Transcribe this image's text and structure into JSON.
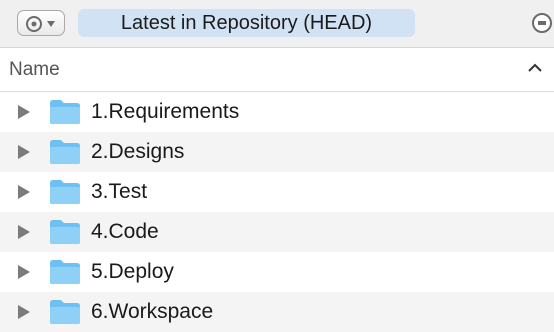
{
  "toolbar": {
    "view_menu_icon": "eye-icon",
    "repository_label": "Latest in Repository (HEAD)",
    "right_icon": "actions-icon"
  },
  "list": {
    "column_header": "Name",
    "sort_icon": "chevron-up-icon",
    "items": [
      {
        "label": "1.Requirements",
        "icon": "folder-icon"
      },
      {
        "label": "2.Designs",
        "icon": "folder-icon"
      },
      {
        "label": "3.Test",
        "icon": "folder-icon"
      },
      {
        "label": "4.Code",
        "icon": "folder-icon"
      },
      {
        "label": "5.Deploy",
        "icon": "folder-icon"
      },
      {
        "label": "6.Workspace",
        "icon": "folder-icon"
      }
    ]
  },
  "colors": {
    "field_highlight": "#d2e2f5",
    "folder_blue": "#6fc0f2",
    "alt_row": "#f4f4f4"
  }
}
